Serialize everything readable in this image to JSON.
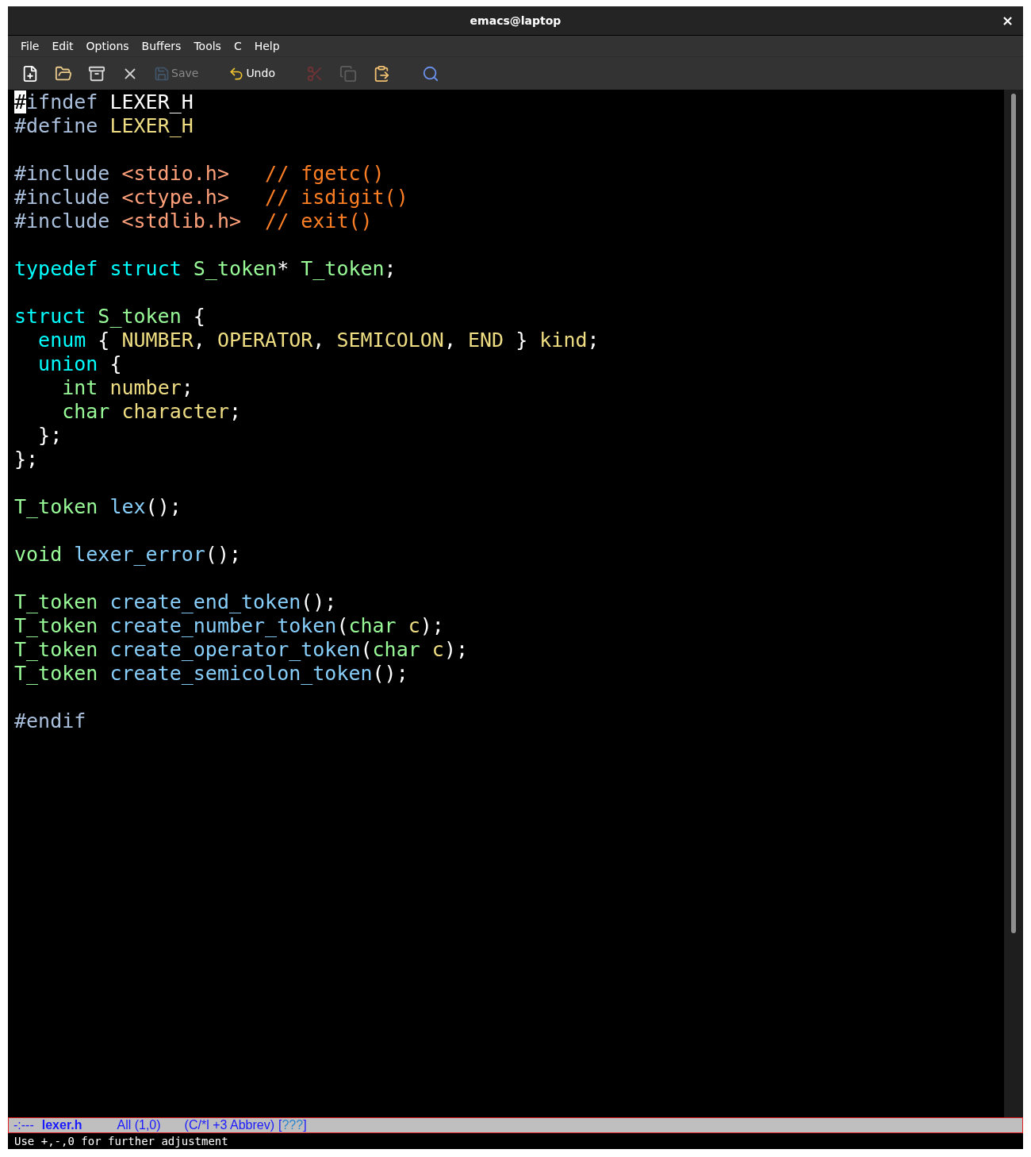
{
  "window": {
    "title": "emacs@laptop",
    "close": "×"
  },
  "menu": [
    {
      "label": "File"
    },
    {
      "label": "Edit"
    },
    {
      "label": "Options"
    },
    {
      "label": "Buffers"
    },
    {
      "label": "Tools"
    },
    {
      "label": "C"
    },
    {
      "label": "Help"
    }
  ],
  "toolbar": [
    {
      "disabled": false
    },
    {
      "disabled": false
    },
    {
      "disabled": false
    },
    {
      "disabled": false
    },
    {
      "label": "Save",
      "disabled": true
    },
    {
      "label": "Undo",
      "disabled": false
    },
    {
      "disabled": true
    },
    {
      "disabled": true
    },
    {
      "disabled": false
    },
    {
      "disabled": false
    }
  ],
  "editor": {
    "lines": [
      {
        "kind": "code",
        "tokens": [
          {
            "text": "#",
            "kind": "cursor"
          },
          {
            "text": "ifndef",
            "kind": "pre"
          },
          {
            "text": " LEXER_H",
            "kind": "plain"
          }
        ]
      },
      {
        "kind": "code",
        "tokens": [
          {
            "text": "#define ",
            "kind": "pre"
          },
          {
            "text": "LEXER_H",
            "kind": "var"
          }
        ]
      },
      {
        "kind": "blank"
      },
      {
        "kind": "code",
        "tokens": [
          {
            "text": "#include ",
            "kind": "pre"
          },
          {
            "text": "<stdio.h>   ",
            "kind": "string"
          },
          {
            "text": "// fgetc()",
            "kind": "comment"
          }
        ]
      },
      {
        "kind": "code",
        "tokens": [
          {
            "text": "#include ",
            "kind": "pre"
          },
          {
            "text": "<ctype.h>   ",
            "kind": "string"
          },
          {
            "text": "// isdigit()",
            "kind": "comment"
          }
        ]
      },
      {
        "kind": "code",
        "tokens": [
          {
            "text": "#include ",
            "kind": "pre"
          },
          {
            "text": "<stdlib.h>  ",
            "kind": "string"
          },
          {
            "text": "// exit()",
            "kind": "comment"
          }
        ]
      },
      {
        "kind": "blank"
      },
      {
        "kind": "code",
        "tokens": [
          {
            "text": "typedef ",
            "kind": "keyword"
          },
          {
            "text": "struct ",
            "kind": "keyword"
          },
          {
            "text": "S_token",
            "kind": "type"
          },
          {
            "text": "* ",
            "kind": "plain"
          },
          {
            "text": "T_token",
            "kind": "type"
          },
          {
            "text": ";",
            "kind": "plain"
          }
        ]
      },
      {
        "kind": "blank"
      },
      {
        "kind": "code",
        "tokens": [
          {
            "text": "struct ",
            "kind": "keyword"
          },
          {
            "text": "S_token",
            "kind": "type"
          },
          {
            "text": " {",
            "kind": "plain"
          }
        ]
      },
      {
        "kind": "code",
        "tokens": [
          {
            "text": "  enum",
            "kind": "keyword"
          },
          {
            "text": " { ",
            "kind": "plain"
          },
          {
            "text": "NUMBER",
            "kind": "var"
          },
          {
            "text": ", ",
            "kind": "plain"
          },
          {
            "text": "OPERATOR",
            "kind": "var"
          },
          {
            "text": ", ",
            "kind": "plain"
          },
          {
            "text": "SEMICOLON",
            "kind": "var"
          },
          {
            "text": ", ",
            "kind": "plain"
          },
          {
            "text": "END",
            "kind": "var"
          },
          {
            "text": " } ",
            "kind": "plain"
          },
          {
            "text": "kind",
            "kind": "var"
          },
          {
            "text": ";",
            "kind": "plain"
          }
        ]
      },
      {
        "kind": "code",
        "tokens": [
          {
            "text": "  union",
            "kind": "keyword"
          },
          {
            "text": " {",
            "kind": "plain"
          }
        ]
      },
      {
        "kind": "code",
        "tokens": [
          {
            "text": "    int ",
            "kind": "type"
          },
          {
            "text": "number",
            "kind": "var"
          },
          {
            "text": ";",
            "kind": "plain"
          }
        ]
      },
      {
        "kind": "code",
        "tokens": [
          {
            "text": "    char ",
            "kind": "type"
          },
          {
            "text": "character",
            "kind": "var"
          },
          {
            "text": ";",
            "kind": "plain"
          }
        ]
      },
      {
        "kind": "code",
        "tokens": [
          {
            "text": "  };",
            "kind": "plain"
          }
        ]
      },
      {
        "kind": "code",
        "tokens": [
          {
            "text": "};",
            "kind": "plain"
          }
        ]
      },
      {
        "kind": "blank"
      },
      {
        "kind": "code",
        "tokens": [
          {
            "text": "T_token ",
            "kind": "type"
          },
          {
            "text": "lex",
            "kind": "func"
          },
          {
            "text": "();",
            "kind": "plain"
          }
        ]
      },
      {
        "kind": "blank"
      },
      {
        "kind": "code",
        "tokens": [
          {
            "text": "void ",
            "kind": "type"
          },
          {
            "text": "lexer_error",
            "kind": "func"
          },
          {
            "text": "();",
            "kind": "plain"
          }
        ]
      },
      {
        "kind": "blank"
      },
      {
        "kind": "code",
        "tokens": [
          {
            "text": "T_token ",
            "kind": "type"
          },
          {
            "text": "create_end_token",
            "kind": "func"
          },
          {
            "text": "();",
            "kind": "plain"
          }
        ]
      },
      {
        "kind": "code",
        "tokens": [
          {
            "text": "T_token ",
            "kind": "type"
          },
          {
            "text": "create_number_token",
            "kind": "func"
          },
          {
            "text": "(",
            "kind": "plain"
          },
          {
            "text": "char ",
            "kind": "type"
          },
          {
            "text": "c",
            "kind": "var"
          },
          {
            "text": ");",
            "kind": "plain"
          }
        ]
      },
      {
        "kind": "code",
        "tokens": [
          {
            "text": "T_token ",
            "kind": "type"
          },
          {
            "text": "create_operator_token",
            "kind": "func"
          },
          {
            "text": "(",
            "kind": "plain"
          },
          {
            "text": "char ",
            "kind": "type"
          },
          {
            "text": "c",
            "kind": "var"
          },
          {
            "text": ");",
            "kind": "plain"
          }
        ]
      },
      {
        "kind": "code",
        "tokens": [
          {
            "text": "T_token ",
            "kind": "type"
          },
          {
            "text": "create_semicolon_token",
            "kind": "func"
          },
          {
            "text": "();",
            "kind": "plain"
          }
        ]
      },
      {
        "kind": "blank"
      },
      {
        "kind": "code",
        "tokens": [
          {
            "text": "#endif",
            "kind": "pre"
          }
        ]
      }
    ]
  },
  "mode_line": [
    {
      "text": "-:---",
      "kind": "plain"
    },
    {
      "text": "lexer.h",
      "kind": "buffer"
    },
    {
      "text": "All (1,0)",
      "kind": "plain"
    },
    {
      "text": "(C/*l +3 Abbrev)",
      "kind": "plain"
    },
    {
      "text": "[",
      "kind": "bracket"
    },
    {
      "text": "???",
      "kind": "faint"
    },
    {
      "text": "]",
      "kind": "bracket"
    }
  ],
  "echo_area": "Use +,-,0 for further adjustment"
}
